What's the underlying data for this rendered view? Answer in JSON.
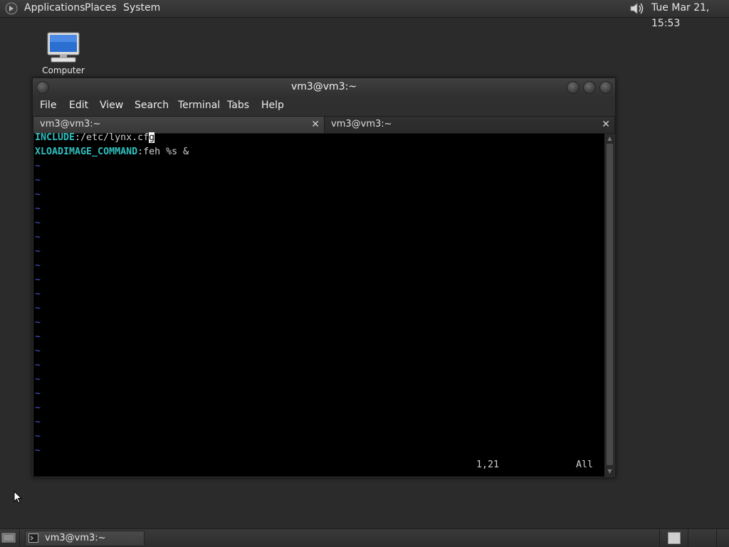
{
  "top_panel": {
    "menus": [
      "Applications",
      "Places",
      "System"
    ],
    "clock": "Tue Mar 21, 15:53",
    "icons": {
      "apps": "gnome-foot-icon",
      "volume": "speaker-icon"
    }
  },
  "desktop": {
    "icons": [
      {
        "label": "Computer",
        "icon": "computer-icon"
      }
    ]
  },
  "terminal": {
    "title": "vm3@vm3:~",
    "menu": [
      "File",
      "Edit",
      "View",
      "Search",
      "Terminal",
      "Tabs",
      "Help"
    ],
    "tabs": [
      {
        "label": "vm3@vm3:~",
        "active": true
      },
      {
        "label": "vm3@vm3:~",
        "active": false
      }
    ],
    "content": {
      "line1_key": "INCLUDE",
      "line1_val": ":/etc/lynx.cf",
      "line1_cursor": "g",
      "line2_key": "XLOADIMAGE_COMMAND",
      "line2_val": ":feh %s &",
      "tilde": "~",
      "status_position": "1,21",
      "status_scroll": "All"
    }
  },
  "bottom_panel": {
    "tasks": [
      {
        "label": "vm3@vm3:~",
        "icon": "terminal-icon"
      }
    ]
  },
  "colors": {
    "keyword": "#2fc0c0",
    "tilde": "#4b5ad8",
    "panel": "#333333",
    "terminal_bg": "#000000"
  }
}
